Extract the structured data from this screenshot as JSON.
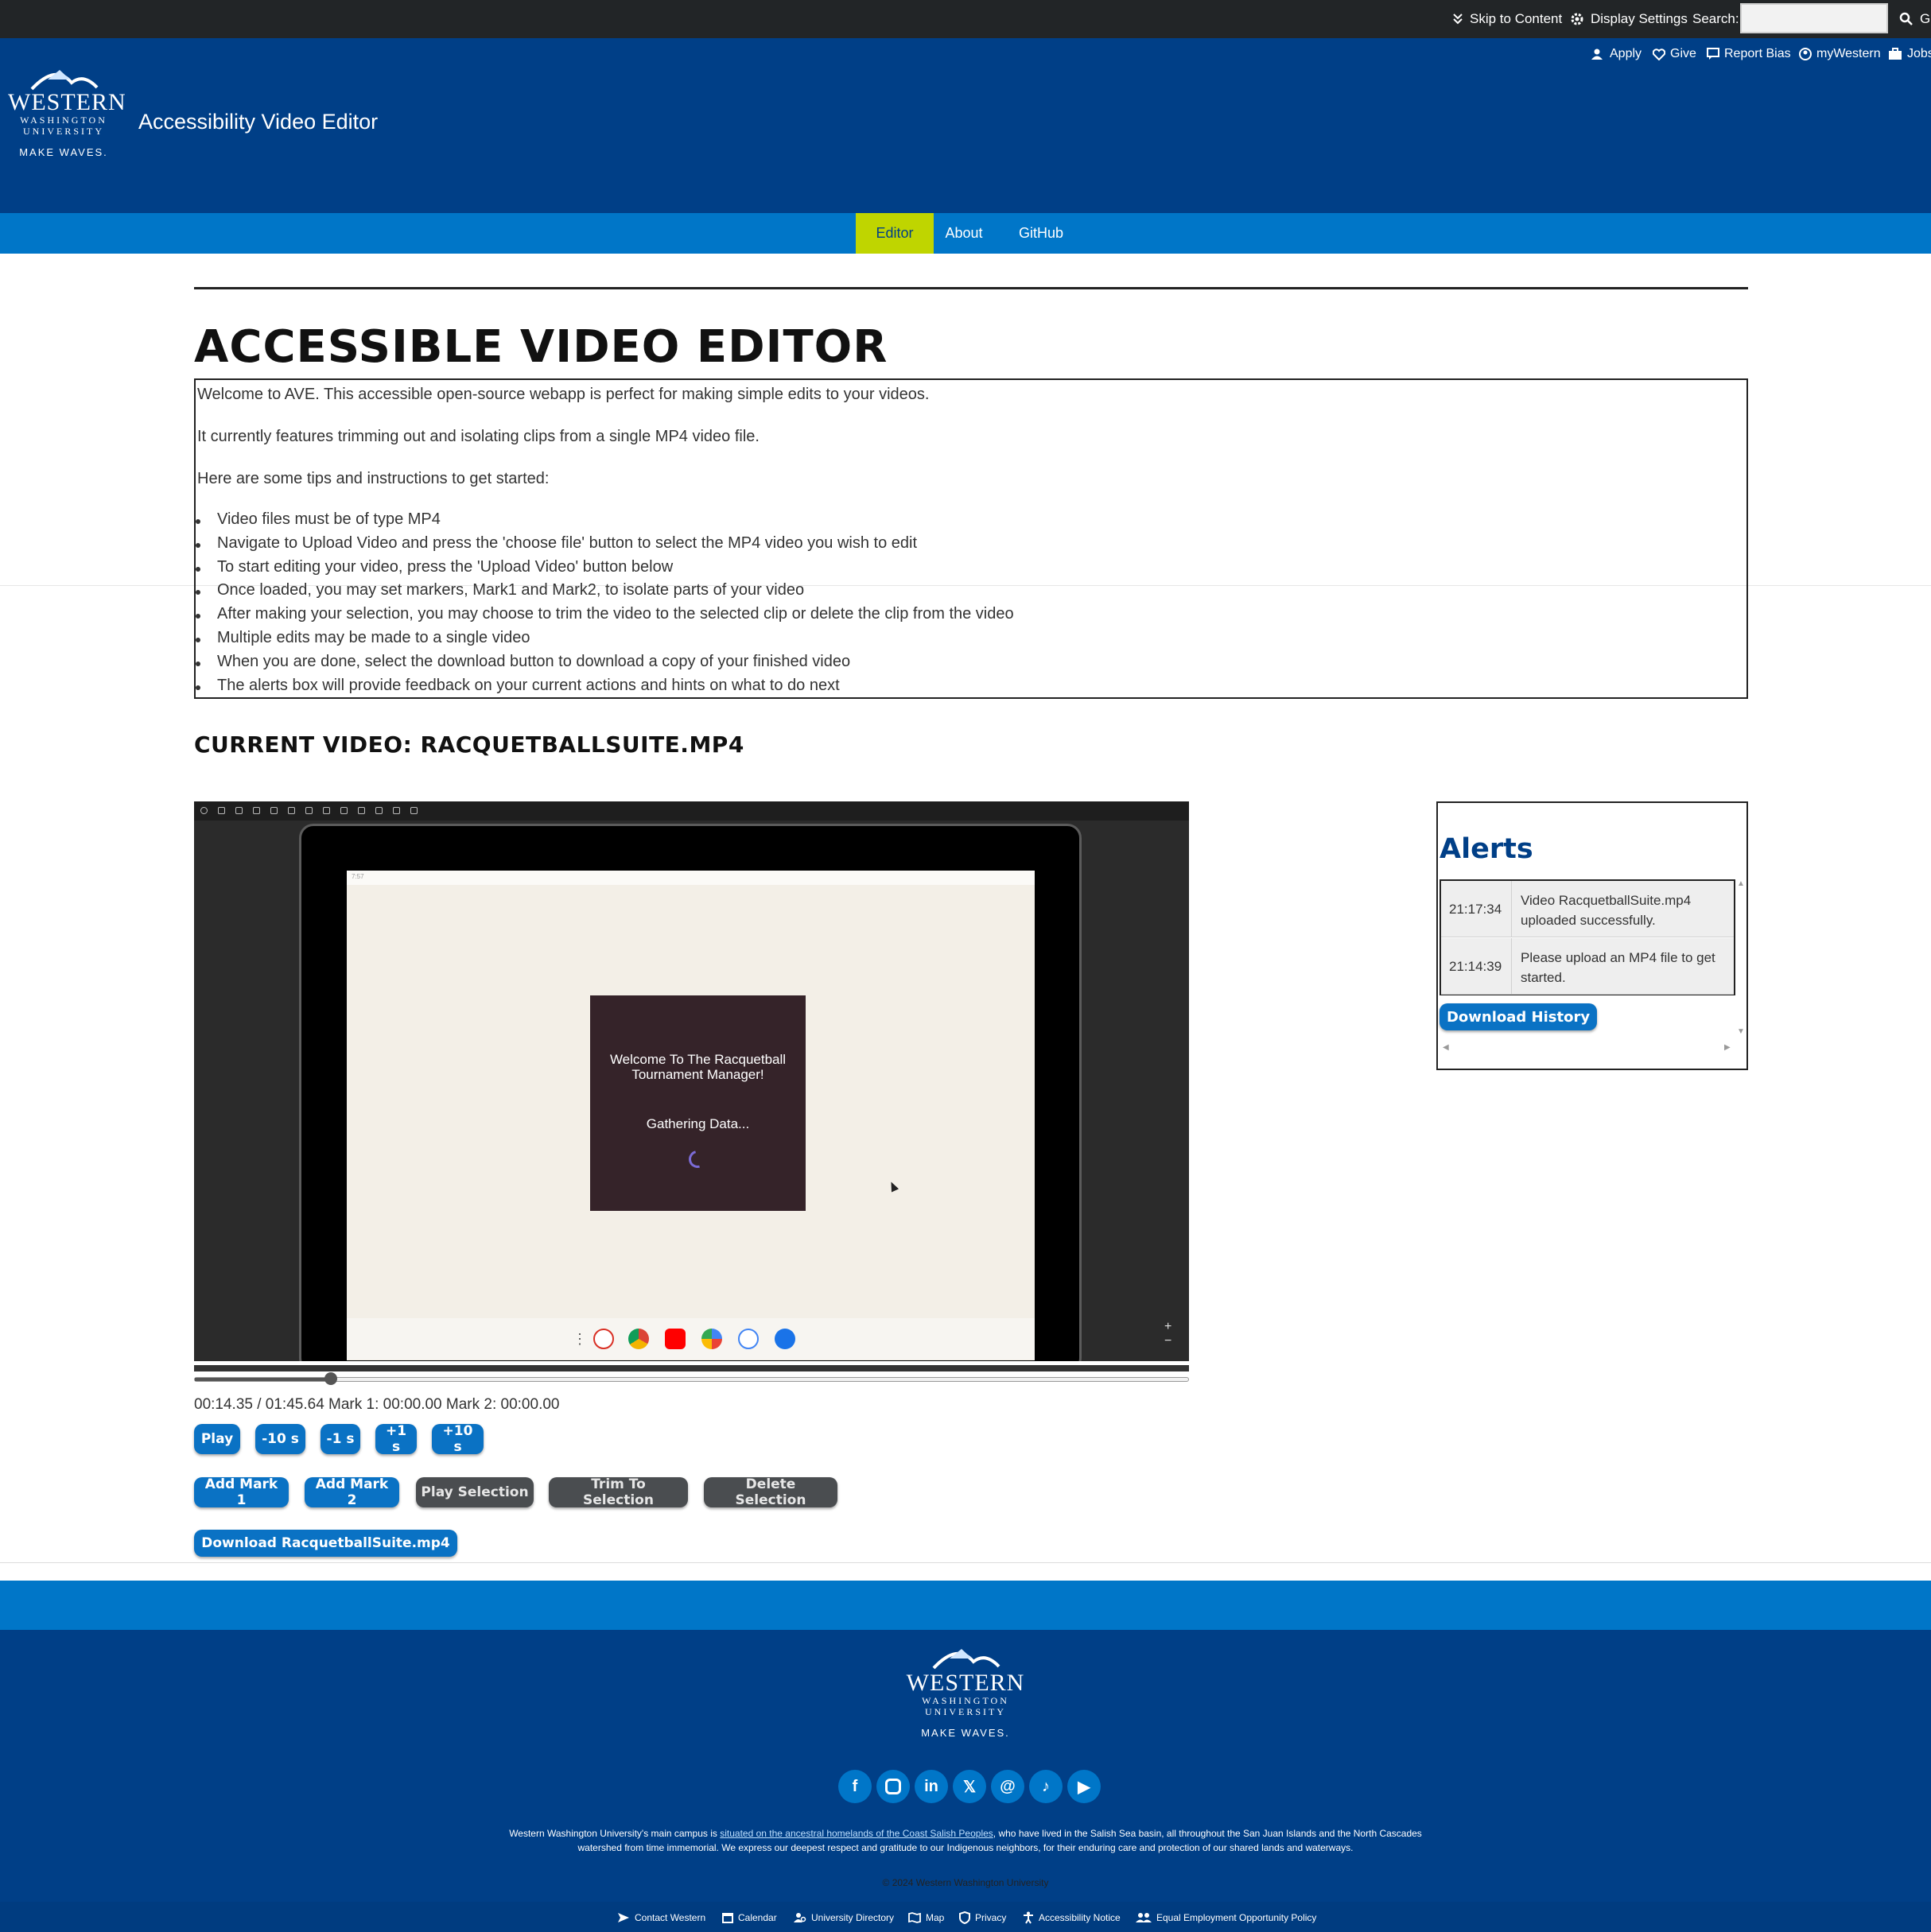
{
  "topbar": {
    "skip": "Skip to Content",
    "display": "Display Settings",
    "search_label": "Search:",
    "search_value": "",
    "go": "Go"
  },
  "util": {
    "apply": "Apply",
    "give": "Give",
    "report": "Report Bias",
    "mywestern": "myWestern",
    "jobs": "Jobs"
  },
  "logo": {
    "line1": "WESTERN",
    "line2": "WASHINGTON",
    "line3": "UNIVERSITY",
    "tagline": "MAKE WAVES."
  },
  "site_title": "Accessibility Video Editor",
  "nav": [
    {
      "label": "Editor",
      "active": true
    },
    {
      "label": "About",
      "active": false
    },
    {
      "label": "GitHub",
      "active": false
    }
  ],
  "heading": "ACCESSIBLE VIDEO EDITOR",
  "intro": {
    "p1": "Welcome to AVE. This accessible open-source webapp is perfect for making simple edits to your videos.",
    "p2": "It currently features trimming out and isolating clips from a single MP4 video file.",
    "p3": "Here are some tips and instructions to get started:",
    "tips": [
      "Video files must be of type MP4",
      "Navigate to Upload Video and press the 'choose file' button to select the MP4 video you wish to edit",
      "To start editing your video, press the 'Upload Video' button below",
      "Once loaded, you may set markers, Mark1 and Mark2, to isolate parts of your video",
      "After making your selection, you may choose to trim the video to the selected clip or delete the clip from the video",
      "Multiple edits may be made to a single video",
      "When you are done, select the download button to download a copy of your finished video",
      "The alerts box will provide feedback on your current actions and hints on what to do next"
    ]
  },
  "current_video": "CURRENT VIDEO: RACQUETBALLSUITE.MP4",
  "video": {
    "status_time": "7:57",
    "dialog_line1": "Welcome To The Racquetball",
    "dialog_line2": "Tournament Manager!",
    "dialog_status": "Gathering Data...",
    "progress_fraction": 0.137
  },
  "timecode": "00:14.35 / 01:45.64 Mark 1: 00:00.00 Mark 2: 00:00.00",
  "controls": {
    "play": "Play",
    "back10": "-10 s",
    "back1": "-1 s",
    "fwd1": "+1 s",
    "fwd10": "+10 s",
    "mark1": "Add Mark 1",
    "mark2": "Add Mark 2",
    "play_sel": "Play Selection",
    "trim": "Trim To Selection",
    "delete": "Delete Selection",
    "download": "Download RacquetballSuite.mp4"
  },
  "alerts": {
    "title": "Alerts",
    "rows": [
      {
        "time": "21:17:34",
        "msg": "Video RacquetballSuite.mp4 uploaded successfully."
      },
      {
        "time": "21:14:39",
        "msg": "Please upload an MP4 file to get started."
      }
    ],
    "download_history": "Download History"
  },
  "footer": {
    "social": [
      "facebook",
      "instagram",
      "linkedin",
      "x",
      "threads",
      "tiktok",
      "youtube"
    ],
    "land_pre": "Western Washington University's main campus is ",
    "land_link": "situated on the ancestral homelands of the Coast Salish Peoples",
    "land_post": ", who have lived in the Salish Sea basin, all throughout the San Juan Islands and the North Cascades",
    "land_line2": "watershed from time immemorial. We express our deepest respect and gratitude to our Indigenous neighbors, for their enduring care and protection of our shared lands and waterways.",
    "copyright": "© 2024 Western Washington University",
    "links": {
      "contact": "Contact Western",
      "calendar": "Calendar",
      "directory": "University Directory",
      "map": "Map",
      "privacy": "Privacy",
      "accessibility": "Accessibility Notice",
      "eeo": "Equal Employment Opportunity Policy"
    }
  },
  "colors": {
    "header": "#003f87",
    "nav": "#0076c8",
    "active_tab": "#bfd500",
    "button": "#0a72c4",
    "button_disabled": "#4a4d50"
  }
}
